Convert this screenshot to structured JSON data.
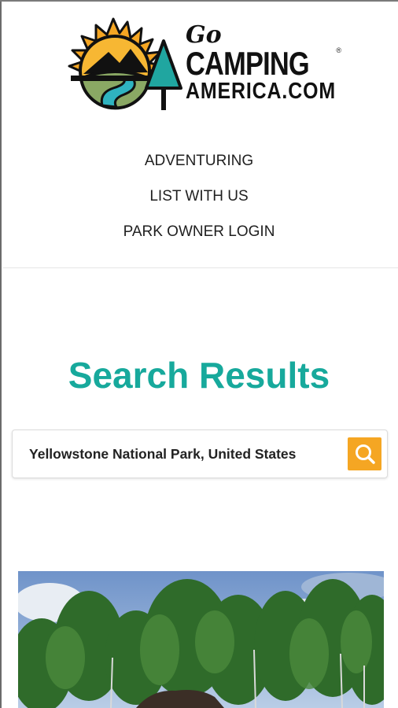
{
  "header": {
    "logo": {
      "go": "Go",
      "camping": "CAMPING",
      "registered": "®",
      "domain": "AMERICA.COM"
    },
    "nav": [
      {
        "label": "ADVENTURING"
      },
      {
        "label": "LIST WITH US"
      },
      {
        "label": "PARK OWNER LOGIN"
      }
    ]
  },
  "main": {
    "title": "Search Results",
    "search": {
      "value": "Yellowstone National Park, United States",
      "button_icon": "search-icon"
    },
    "result_image": {
      "description_icon": "campground-photo"
    }
  },
  "colors": {
    "accent": "#17a99c",
    "search_button": "#f5a623"
  }
}
